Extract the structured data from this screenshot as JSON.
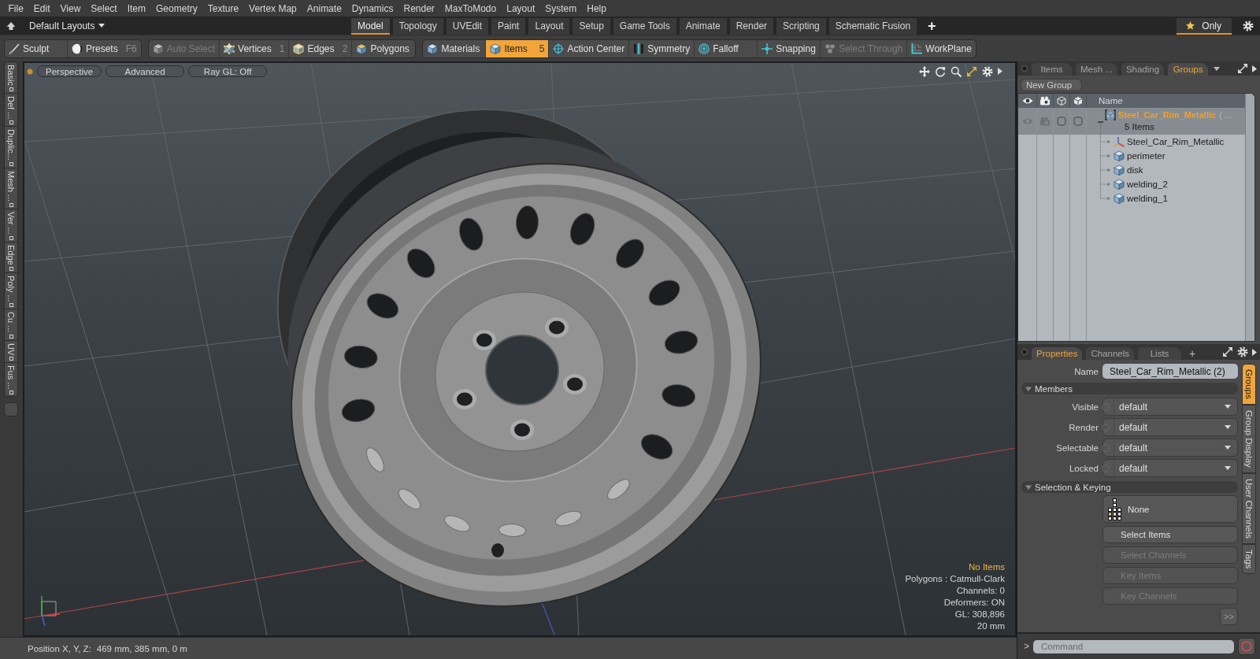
{
  "menu_bar": [
    "File",
    "Edit",
    "View",
    "Select",
    "Item",
    "Geometry",
    "Texture",
    "Vertex Map",
    "Animate",
    "Dynamics",
    "Render",
    "MaxToModo",
    "Layout",
    "System",
    "Help"
  ],
  "layout_bar": {
    "layouts_menu": "Default Layouts",
    "tabs": [
      {
        "label": "Model",
        "selected": true
      },
      {
        "label": "Topology",
        "selected": false
      },
      {
        "label": "UVEdit",
        "selected": false
      },
      {
        "label": "Paint",
        "selected": false
      },
      {
        "label": "Layout",
        "selected": false
      },
      {
        "label": "Setup",
        "selected": false
      },
      {
        "label": "Game Tools",
        "selected": false
      },
      {
        "label": "Animate",
        "selected": false
      },
      {
        "label": "Render",
        "selected": false
      },
      {
        "label": "Scripting",
        "selected": false
      },
      {
        "label": "Schematic Fusion",
        "selected": false
      }
    ],
    "add_tab": "+",
    "only_filter": {
      "label": "Only",
      "on": true
    }
  },
  "toolbar": {
    "groups": [
      {
        "tools": [
          {
            "kind": "sculpt",
            "label": "Sculpt",
            "selected": false,
            "disabled": false
          },
          {
            "kind": "presets",
            "label": "Presets",
            "shortcut": "F6",
            "selected": false,
            "disabled": false
          }
        ]
      },
      {
        "tools": [
          {
            "kind": "auto_select",
            "label": "Auto Select",
            "selected": false,
            "disabled": true
          },
          {
            "kind": "vertices",
            "label": "Vertices",
            "shortcut": "1",
            "selected": false,
            "disabled": false
          },
          {
            "kind": "edges",
            "label": "Edges",
            "shortcut": "2",
            "selected": false,
            "disabled": false
          },
          {
            "kind": "polygons",
            "label": "Polygons",
            "selected": false,
            "disabled": false
          }
        ]
      },
      {
        "tools": [
          {
            "kind": "materials",
            "label": "Materials",
            "selected": false,
            "disabled": false
          },
          {
            "kind": "items",
            "label": "Items",
            "shortcut": "5",
            "selected": true,
            "disabled": false
          },
          {
            "kind": "action_center",
            "label": "Action Center",
            "selected": false,
            "disabled": false
          },
          {
            "kind": "symmetry",
            "label": "Symmetry",
            "selected": false,
            "disabled": false
          },
          {
            "kind": "falloff",
            "label": "Falloff",
            "selected": false,
            "disabled": false
          },
          {
            "kind": "snapping",
            "label": "Snapping",
            "selected": false,
            "disabled": false
          },
          {
            "kind": "select_through",
            "label": "Select Through",
            "selected": false,
            "disabled": true
          },
          {
            "kind": "workplane",
            "label": "WorkPlane",
            "selected": false,
            "disabled": false
          }
        ]
      }
    ]
  },
  "tool_palette": {
    "tabs": [
      {
        "label": "Basic",
        "selected": false
      },
      {
        "label": "Def ...",
        "selected": false
      },
      {
        "label": "Duplic...",
        "selected": false
      },
      {
        "label": "Mesh ...",
        "selected": false
      },
      {
        "label": "Ver ...",
        "selected": false
      },
      {
        "label": "Edge",
        "selected": false
      },
      {
        "label": "Poly ...",
        "selected": false
      },
      {
        "label": "Cu ...",
        "selected": false
      },
      {
        "label": "UV",
        "selected": false
      },
      {
        "label": "Fus ...",
        "selected": false
      }
    ]
  },
  "viewport": {
    "view_buttons": [
      "Perspective",
      "Advanced",
      "Ray GL: Off"
    ],
    "info_lines": [
      {
        "text": "No Items",
        "highlighted": true
      },
      {
        "text": "Polygons : Catmull-Clark",
        "highlighted": false
      },
      {
        "text": "Channels: 0",
        "highlighted": false
      },
      {
        "text": "Deformers: ON",
        "highlighted": false
      },
      {
        "text": "GL: 308,896",
        "highlighted": false
      },
      {
        "text": "20 mm",
        "highlighted": false
      }
    ]
  },
  "status_bar": {
    "label": "Position X, Y, Z:",
    "value": "469 mm, 385 mm, 0 m"
  },
  "items_panel": {
    "tabs": [
      {
        "label": "Items",
        "selected": false
      },
      {
        "label": "Mesh ...",
        "selected": false
      },
      {
        "label": "Shading",
        "selected": false
      },
      {
        "label": "Groups",
        "selected": true
      }
    ],
    "new_group_button": "New Group",
    "name_column": "Name",
    "groups": [
      {
        "name": "Steel_Car_Rim_Metallic",
        "suffix": "( ...",
        "count": "5 Items",
        "selected": true,
        "expanded": true,
        "children": [
          {
            "name": "Steel_Car_Rim_Metallic",
            "kind": "locator",
            "selected": false
          },
          {
            "name": "perimeter",
            "kind": "mesh",
            "selected": false
          },
          {
            "name": "disk",
            "kind": "mesh",
            "selected": false
          },
          {
            "name": "welding_2",
            "kind": "mesh",
            "selected": false
          },
          {
            "name": "welding_1",
            "kind": "mesh",
            "selected": false
          }
        ]
      }
    ]
  },
  "properties_panel": {
    "tabs": [
      {
        "label": "Properties",
        "selected": true
      },
      {
        "label": "Channels",
        "selected": false
      },
      {
        "label": "Lists",
        "selected": false
      }
    ],
    "add_tab": "+",
    "name_field": {
      "label": "Name",
      "value": "Steel_Car_Rim_Metallic (2)"
    },
    "sections": [
      {
        "kind": "fields",
        "title": "Members",
        "expanded": true,
        "fields": [
          {
            "label": "Visible",
            "value": "default"
          },
          {
            "label": "Render",
            "value": "default"
          },
          {
            "label": "Selectable",
            "value": "default"
          },
          {
            "label": "Locked",
            "value": "default"
          }
        ]
      },
      {
        "kind": "actions",
        "title": "Selection & Keying",
        "expanded": true,
        "buttons": [
          {
            "kind": "preset",
            "label": "None",
            "disabled": false
          },
          {
            "kind": "action",
            "label": "Select Items",
            "disabled": false
          },
          {
            "kind": "action",
            "label": "Select Channels",
            "disabled": true
          },
          {
            "kind": "action",
            "label": "Key Items",
            "disabled": true
          },
          {
            "kind": "action",
            "label": "Key Channels",
            "disabled": true
          }
        ]
      }
    ],
    "more_button": ">>",
    "side_tabs": [
      {
        "label": "Groups",
        "selected": true
      },
      {
        "label": "Group Display",
        "selected": false
      },
      {
        "label": "User Channels",
        "selected": false
      },
      {
        "label": "Tags",
        "selected": false
      }
    ]
  },
  "command_bar": {
    "prompt": ">",
    "placeholder": "Command"
  }
}
